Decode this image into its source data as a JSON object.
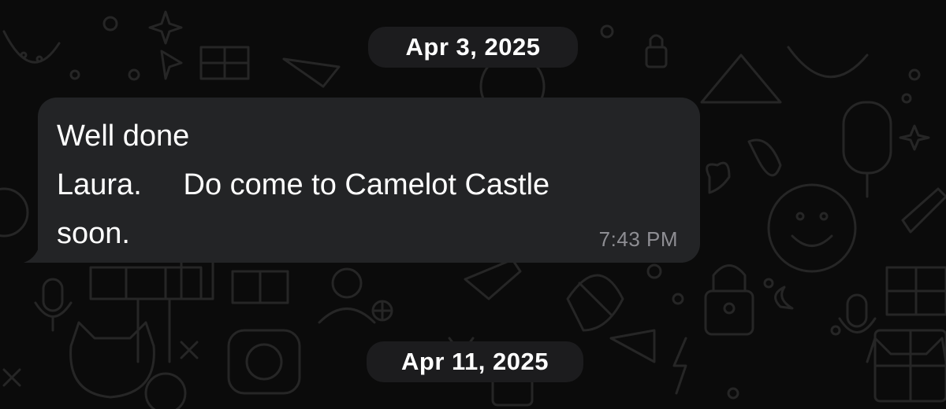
{
  "chat": {
    "date_separators": [
      "Apr 3, 2025",
      "Apr 11, 2025"
    ],
    "message": {
      "lines": [
        "Well done",
        "Laura.     Do come to Camelot Castle",
        "soon."
      ],
      "time": "7:43 PM",
      "direction": "incoming"
    }
  },
  "colors": {
    "background": "#0b0b0b",
    "doodle": "#262626",
    "bubble": "#232426",
    "pill": "#1c1c1e",
    "text": "#ffffff",
    "timestamp": "#8e8e93"
  }
}
